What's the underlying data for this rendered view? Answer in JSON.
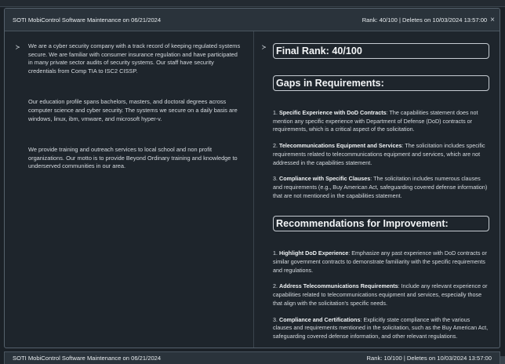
{
  "card": {
    "title": "SOTI MobiControl Software Maintenance on 06/21/2024",
    "meta": "Rank: 40/100 | Deletes on 10/03/2024 13:57:00",
    "close_icon": "×"
  },
  "left": {
    "prompt_icon": "≻",
    "paragraphs": [
      "We are a cyber security company with a track record of keeping regulated systems secure. We are familiar with consumer insurance regulation and have participated in many private sector audits of security systems. Our staff have security credentials from Comp TIA to ISC2 CISSP.",
      "Our education profile spans bachelors, masters, and doctoral degrees across computer science and cyber security. The systems we secure on a daily basis are windows, linux, ibm, vmware, and microsoft hyper-v.",
      "We provide training and outreach services to local school and non profit organizations. Our motto is to provide Beyond Ordinary training and knowledge to underserved communities in our area."
    ]
  },
  "right": {
    "prompt_icon": "≻",
    "final_rank": "Final Rank: 40/100",
    "gaps_heading": "Gaps in Requirements:",
    "gaps": [
      {
        "num": "1.",
        "title": "Specific Experience with DoD Contracts",
        "text": ": The capabilities statement does not mention any specific experience with Department of Defense (DoD) contracts or requirements, which is a critical aspect of the solicitation."
      },
      {
        "num": "2.",
        "title": "Telecommunications Equipment and Services",
        "text": ": The solicitation includes specific requirements related to telecommunications equipment and services, which are not addressed in the capabilities statement."
      },
      {
        "num": "3.",
        "title": "Compliance with Specific Clauses",
        "text": ": The solicitation includes numerous clauses and requirements (e.g., Buy American Act, safeguarding covered defense information) that are not mentioned in the capabilities statement."
      }
    ],
    "rec_heading": "Recommendations for Improvement:",
    "recs": [
      {
        "num": "1.",
        "title": "Highlight DoD Experience",
        "text": ": Emphasize any past experience with DoD contracts or similar government contracts to demonstrate familiarity with the specific requirements and regulations."
      },
      {
        "num": "2.",
        "title": "Address Telecommunications Requirements",
        "text": ": Include any relevant experience or capabilities related to telecommunications equipment and services, especially those that align with the solicitation's specific needs."
      },
      {
        "num": "3.",
        "title": "Compliance and Certifications",
        "text": ": Explicitly state compliance with the various clauses and requirements mentioned in the solicitation, such as the Buy American Act, safeguarding covered defense information, and other relevant regulations."
      }
    ]
  },
  "bottom": {
    "title": "SOTI MobiControl Software Maintenance on 06/21/2024",
    "meta": "Rank: 10/100 | Deletes on 10/03/2024 13:57:00"
  }
}
